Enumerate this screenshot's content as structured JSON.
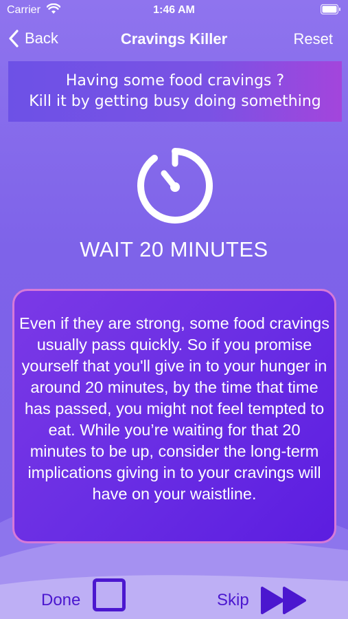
{
  "status_bar": {
    "carrier": "Carrier",
    "time": "1:46 AM"
  },
  "nav": {
    "back_label": "Back",
    "title": "Cravings Killer",
    "reset_label": "Reset"
  },
  "banner": {
    "line1": "Having some food cravings ?",
    "line2": "Kill it by getting busy doing something"
  },
  "tip": {
    "title": "WAIT 20 MINUTES",
    "body": "Even if they are strong, some food cravings usually pass quickly. So if you promise yourself that you'll give in to your hunger in around 20 minutes, by the time that time has passed, you might not feel tempted to eat. While you’re waiting for that 20 minutes to be up, consider the long-term implications giving in to your cravings will have on your waistline."
  },
  "actions": {
    "done_label": "Done",
    "skip_label": "Skip"
  },
  "icons": {
    "back": "chevron-left-icon",
    "timer": "stopwatch-icon",
    "checkbox": "checkbox-icon",
    "skip": "fast-forward-icon",
    "wifi": "wifi-icon",
    "battery": "battery-icon"
  },
  "colors": {
    "background": "#8066ea",
    "accent_dark": "#4b17cf",
    "card": "#6a2ee4",
    "card_border": "#d67ad8"
  }
}
